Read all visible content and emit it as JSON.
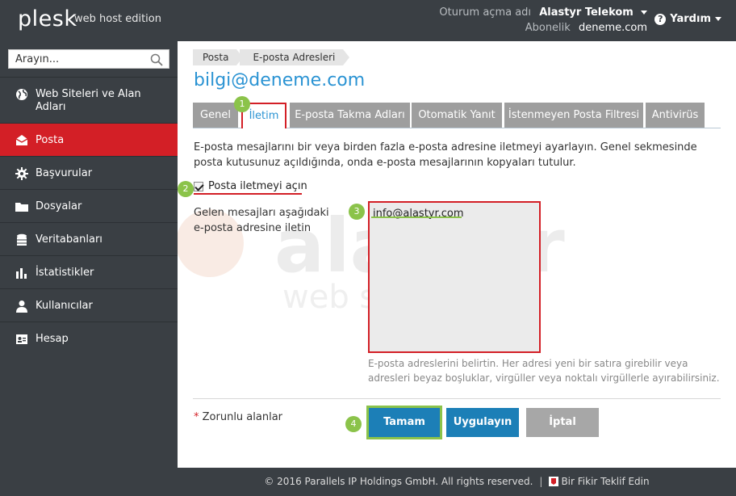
{
  "header": {
    "logo": "plesk",
    "edition": "web host edition",
    "login_label": "Oturum açma adı",
    "login_value": "Alastyr Telekom",
    "subscription_label": "Abonelik",
    "subscription_value": "deneme.com",
    "help_label": "Yardım"
  },
  "sidebar": {
    "search_placeholder": "Arayın...",
    "items": [
      {
        "label": "Web Siteleri ve Alan Adları",
        "icon": "globe-icon",
        "active": false
      },
      {
        "label": "Posta",
        "icon": "envelope-icon",
        "active": true
      },
      {
        "label": "Başvurular",
        "icon": "gear-icon",
        "active": false
      },
      {
        "label": "Dosyalar",
        "icon": "folder-icon",
        "active": false
      },
      {
        "label": "Veritabanları",
        "icon": "database-icon",
        "active": false
      },
      {
        "label": "İstatistikler",
        "icon": "bar-chart-icon",
        "active": false
      },
      {
        "label": "Kullanıcılar",
        "icon": "user-icon",
        "active": false
      },
      {
        "label": "Hesap",
        "icon": "account-icon",
        "active": false
      }
    ]
  },
  "main": {
    "breadcrumb": [
      "Posta",
      "E-posta Adresleri"
    ],
    "title": "bilgi@deneme.com",
    "tabs": [
      {
        "label": "Genel",
        "active": false
      },
      {
        "label": "İletim",
        "active": true
      },
      {
        "label": "E-posta Takma Adları",
        "active": false
      },
      {
        "label": "Otomatik Yanıt",
        "active": false
      },
      {
        "label": "İstenmeyen Posta Filtresi",
        "active": false
      },
      {
        "label": "Antivirüs",
        "active": false
      }
    ],
    "description": "E-posta mesajlarını bir veya birden fazla e-posta adresine iletmeyi ayarlayın. Genel sekmesinde posta kutusunuz açıldığında, onda e-posta mesajlarının kopyaları tutulur.",
    "forward_checkbox_label": "Posta iletmeyi açın",
    "forward_checkbox_checked": true,
    "forward_field_label": "Gelen mesajları aşağıdaki e-posta adresine iletin",
    "forward_field_value": "info@alastyr.com",
    "forward_hint": "E-posta adreslerini belirtin. Her adresi yeni bir satıra girebilir veya adresleri beyaz boşluklar, virgüller veya noktalı virgüllerle ayırabilirsiniz.",
    "required_note": "Zorunlu alanlar",
    "required_star": "*",
    "buttons": {
      "ok": "Tamam",
      "apply": "Uygulayın",
      "cancel": "İptal"
    }
  },
  "markers": [
    "1",
    "2",
    "3",
    "4"
  ],
  "watermark": {
    "brand": "alastyr",
    "tagline": "web solutions"
  },
  "footer": {
    "copyright": "© 2016 Parallels IP Holdings GmbH. All rights reserved.",
    "separator": "|",
    "feedback": "Bir Fikir Teklif Edin"
  },
  "colors": {
    "sidebar_bg": "#3a3f44",
    "active_red": "#d31f26",
    "title_blue": "#2a93d3",
    "button_blue": "#1c7fb7",
    "marker_green": "#8bc34a",
    "tab_gray": "#9e9e9e"
  }
}
